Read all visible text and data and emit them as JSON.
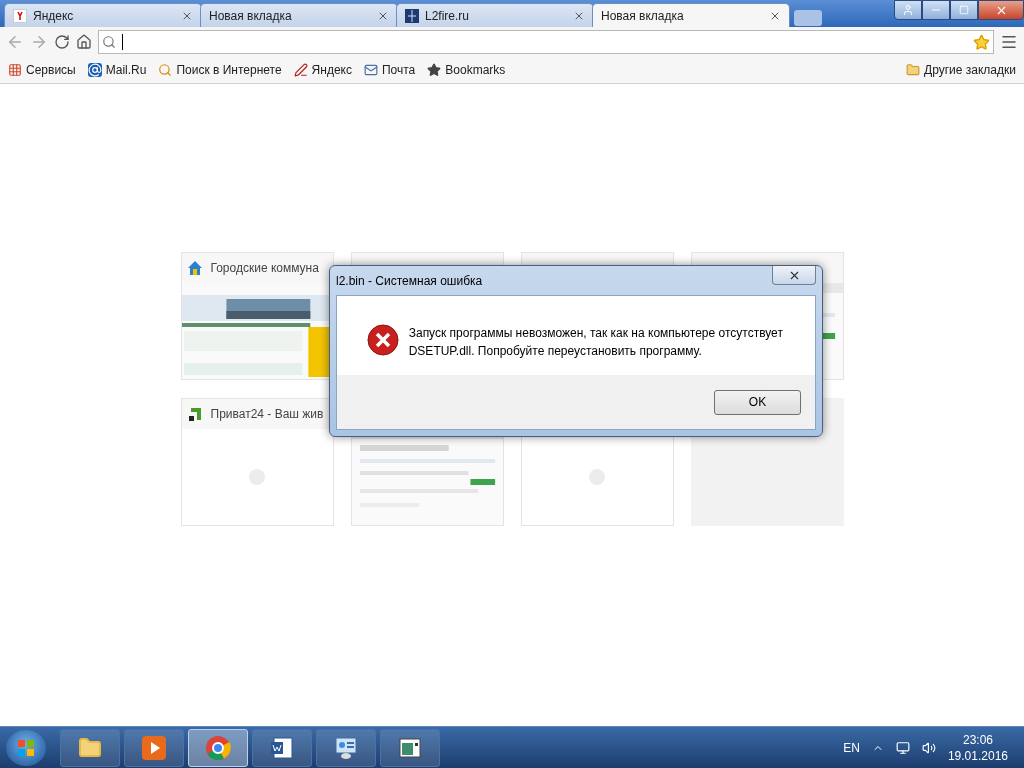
{
  "tabs": [
    {
      "title": "Яндекс",
      "selected": false
    },
    {
      "title": "Новая вкладка",
      "selected": false
    },
    {
      "title": "L2fire.ru",
      "selected": false
    },
    {
      "title": "Новая вкладка",
      "selected": true
    }
  ],
  "bookmarks": [
    {
      "label": "Сервисы"
    },
    {
      "label": "Mail.Ru"
    },
    {
      "label": "Поиск в Интернете"
    },
    {
      "label": "Яндекс"
    },
    {
      "label": "Почта"
    },
    {
      "label": "Bookmarks"
    }
  ],
  "other_bookmarks": "Другие закладки",
  "thumbnails": [
    {
      "title": "Городские коммуна",
      "kind": "picture"
    },
    {
      "kind": "covered"
    },
    {
      "kind": "covered"
    },
    {
      "kind": "picture"
    },
    {
      "title": "Приват24 - Ваш жив",
      "kind": "blank"
    },
    {
      "kind": "picture"
    },
    {
      "kind": "blank"
    },
    {
      "kind": "empty"
    }
  ],
  "dialog": {
    "title": "l2.bin - Системная ошибка",
    "message": "Запуск программы невозможен, так как на компьютере отсутствует DSETUP.dll. Попробуйте переустановить программу.",
    "button": "OK"
  },
  "taskbar": {
    "apps": [
      {
        "selected": false
      },
      {
        "selected": false
      },
      {
        "selected": true
      },
      {
        "selected": false
      },
      {
        "selected": false
      },
      {
        "selected": false
      }
    ],
    "language": "EN",
    "time": "23:06",
    "date": "19.01.2016"
  }
}
